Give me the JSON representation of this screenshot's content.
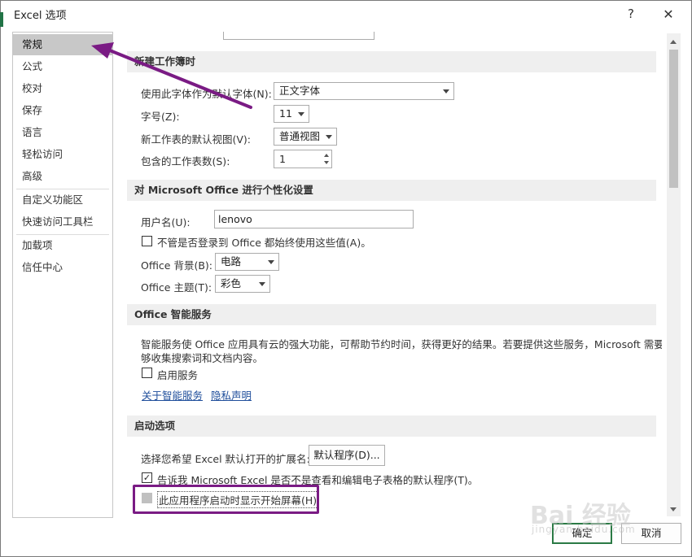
{
  "window": {
    "title": "Excel 选项",
    "help": "?",
    "close": "✕"
  },
  "sidebar": {
    "items": [
      {
        "label": "常规"
      },
      {
        "label": "公式"
      },
      {
        "label": "校对"
      },
      {
        "label": "保存"
      },
      {
        "label": "语言"
      },
      {
        "label": "轻松访问"
      },
      {
        "label": "高级"
      },
      {
        "label": "自定义功能区"
      },
      {
        "label": "快速访问工具栏"
      },
      {
        "label": "加载项"
      },
      {
        "label": "信任中心"
      }
    ]
  },
  "new_workbook": {
    "header": "新建工作簿时",
    "font_label": "使用此字体作为默认字体(N):",
    "font_value": "正文字体",
    "size_label": "字号(Z):",
    "size_value": "11",
    "view_label": "新工作表的默认视图(V):",
    "view_value": "普通视图",
    "sheets_label": "包含的工作表数(S):",
    "sheets_value": "1"
  },
  "personalize": {
    "header": "对 Microsoft Office 进行个性化设置",
    "username_label": "用户名(U):",
    "username_value": "lenovo",
    "always_use_label": "不管是否登录到 Office 都始终使用这些值(A)。",
    "background_label": "Office 背景(B):",
    "background_value": "电路",
    "theme_label": "Office 主题(T):",
    "theme_value": "彩色"
  },
  "intelligent": {
    "header": "Office 智能服务",
    "desc_line1": "智能服务使 Office 应用具有云的强大功能，可帮助节约时间，获得更好的结果。若要提供这些服务，Microsoft 需要能",
    "desc_line2": "够收集搜索词和文档内容。",
    "enable_label": "启用服务",
    "about_link": "关于智能服务",
    "privacy_link": "隐私声明"
  },
  "startup": {
    "header": "启动选项",
    "ext_label": "选择您希望 Excel 默认打开的扩展名:",
    "default_programs_button": "默认程序(D)...",
    "tell_me_label": "告诉我 Microsoft Excel 是否不是查看和编辑电子表格的默认程序(T)。",
    "tell_me_checked": true,
    "show_start_label": "此应用程序启动时显示开始屏幕(H)",
    "show_start_checked": false
  },
  "footer": {
    "ok": "确定",
    "cancel": "取消"
  },
  "watermark": {
    "main": "Bai 经验",
    "sub": "jingyan.baidu.com"
  },
  "colors": {
    "annotation": "#7a1b84",
    "excel_green": "#217346",
    "link": "#1f4e9b"
  }
}
